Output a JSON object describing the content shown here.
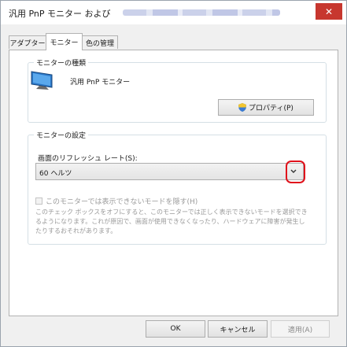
{
  "window": {
    "title": "汎用 PnP モニター および",
    "close_glyph": "✕"
  },
  "tabs": [
    {
      "label": "アダプター"
    },
    {
      "label": "モニター"
    },
    {
      "label": "色の管理"
    }
  ],
  "monitor_type": {
    "group_label": "モニターの種類",
    "monitor_name": "汎用 PnP モニター",
    "icon": "monitor-icon",
    "properties_button": "プロパティ(P)"
  },
  "monitor_settings": {
    "group_label": "モニターの設定",
    "refresh_rate_label": "画面のリフレッシュ レート(S):",
    "refresh_rate_value": "60 ヘルツ",
    "hide_modes_label": "このモニターでは表示できないモードを隠す(H)",
    "hide_modes_checked": false,
    "description": "このチェック ボックスをオフにすると、このモニターでは正しく表示できないモードを選択できるようになります。これが原因で、画面が使用できなくなったり、ハードウェアに障害が発生したりするおそれがあります。"
  },
  "footer": {
    "ok": "OK",
    "cancel": "キャンセル",
    "apply": "適用(A)"
  },
  "colors": {
    "close_red": "#c7372f",
    "highlight_red": "#e0111b",
    "disabled_text": "#9a9a9a"
  }
}
